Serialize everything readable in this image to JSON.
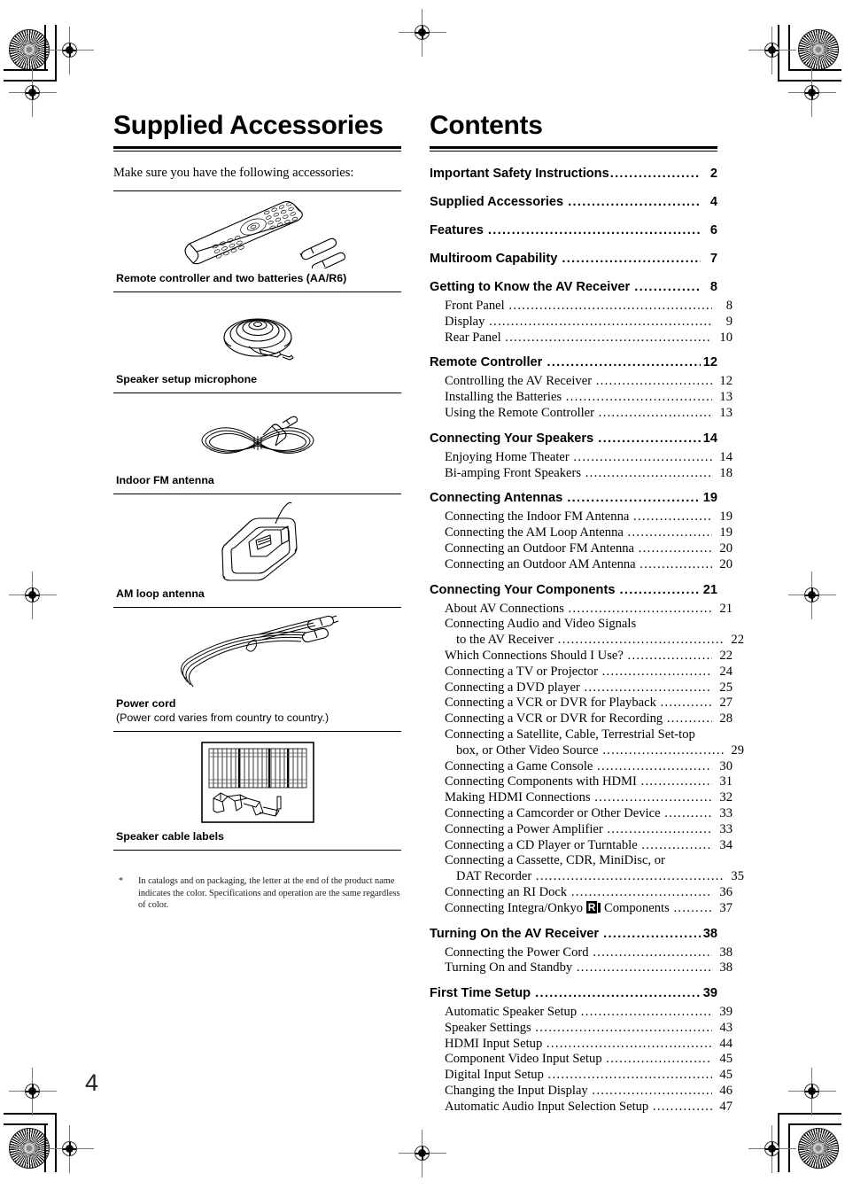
{
  "page": {
    "number": "4"
  },
  "left": {
    "title": "Supplied Accessories",
    "intro": "Make sure you have the following accessories:",
    "accessories": [
      {
        "caption": "Remote controller and two batteries (AA/R6)",
        "sub": "",
        "art": "remote-controller-illustration"
      },
      {
        "caption": "Speaker setup microphone",
        "sub": "",
        "art": "setup-microphone-illustration"
      },
      {
        "caption": "Indoor FM antenna",
        "sub": "",
        "art": "fm-antenna-illustration"
      },
      {
        "caption": "AM loop antenna",
        "sub": "",
        "art": "am-loop-antenna-illustration"
      },
      {
        "caption": "Power cord",
        "sub": "(Power cord varies from country to country.)",
        "art": "power-cord-illustration"
      },
      {
        "caption": "Speaker cable labels",
        "sub": "",
        "art": "speaker-cable-labels-illustration"
      }
    ],
    "footnote_marker": "*",
    "footnote": "In catalogs and on packaging, the letter at the end of the product name indicates the color. Specifications and operation are the same regardless of color."
  },
  "right": {
    "title": "Contents",
    "entries": [
      {
        "level": 1,
        "label": "Important Safety Instructions",
        "page": "2"
      },
      {
        "level": 1,
        "label": "Supplied Accessories ",
        "page": "4"
      },
      {
        "level": 1,
        "label": "Features ",
        "page": "6"
      },
      {
        "level": 1,
        "label": "Multiroom Capability ",
        "page": "7"
      },
      {
        "level": 1,
        "label": "Getting to Know the AV Receiver ",
        "page": "8"
      },
      {
        "level": 2,
        "label": "Front Panel ",
        "page": "8"
      },
      {
        "level": 2,
        "label": "Display ",
        "page": "9"
      },
      {
        "level": 2,
        "label": "Rear Panel ",
        "page": "10"
      },
      {
        "level": 1,
        "label": "Remote Controller ",
        "page": "12"
      },
      {
        "level": 2,
        "label": "Controlling the AV Receiver ",
        "page": "12"
      },
      {
        "level": 2,
        "label": "Installing the Batteries ",
        "page": "13"
      },
      {
        "level": 2,
        "label": "Using the Remote Controller ",
        "page": "13"
      },
      {
        "level": 1,
        "label": "Connecting Your Speakers ",
        "page": "14"
      },
      {
        "level": 2,
        "label": "Enjoying Home Theater ",
        "page": "14"
      },
      {
        "level": 2,
        "label": "Bi-amping Front Speakers ",
        "page": "18"
      },
      {
        "level": 1,
        "label": "Connecting Antennas ",
        "page": "19"
      },
      {
        "level": 2,
        "label": "Connecting the Indoor FM Antenna ",
        "page": "19"
      },
      {
        "level": 2,
        "label": "Connecting the AM Loop Antenna ",
        "page": "19"
      },
      {
        "level": 2,
        "label": "Connecting an Outdoor FM Antenna ",
        "page": "20"
      },
      {
        "level": 2,
        "label": "Connecting an Outdoor AM Antenna ",
        "page": "20"
      },
      {
        "level": 1,
        "label": "Connecting Your Components ",
        "page": "21"
      },
      {
        "level": 2,
        "label": "About AV Connections ",
        "page": "21"
      },
      {
        "level": 2,
        "label": "Connecting Audio and Video Signals",
        "page": "",
        "nodots": true
      },
      {
        "level": 2,
        "label": "to the AV Receiver ",
        "page": "22",
        "cont": true
      },
      {
        "level": 2,
        "label": "Which Connections Should I Use? ",
        "page": "22"
      },
      {
        "level": 2,
        "label": "Connecting a TV or Projector ",
        "page": "24"
      },
      {
        "level": 2,
        "label": "Connecting a DVD player ",
        "page": "25"
      },
      {
        "level": 2,
        "label": "Connecting a VCR or DVR for Playback ",
        "page": "27"
      },
      {
        "level": 2,
        "label": "Connecting a VCR or DVR for Recording ",
        "page": "28"
      },
      {
        "level": 2,
        "label": "Connecting a Satellite, Cable, Terrestrial Set-top",
        "page": "",
        "nodots": true
      },
      {
        "level": 2,
        "label": "box, or Other Video Source ",
        "page": "29",
        "cont": true
      },
      {
        "level": 2,
        "label": "Connecting a Game Console ",
        "page": "30"
      },
      {
        "level": 2,
        "label": "Connecting Components with HDMI ",
        "page": "31"
      },
      {
        "level": 2,
        "label": "Making HDMI Connections ",
        "page": "32"
      },
      {
        "level": 2,
        "label": "Connecting a Camcorder or Other Device ",
        "page": "33"
      },
      {
        "level": 2,
        "label": "Connecting a Power Amplifier ",
        "page": "33"
      },
      {
        "level": 2,
        "label": "Connecting a CD Player or Turntable ",
        "page": "34"
      },
      {
        "level": 2,
        "label": "Connecting a Cassette, CDR, MiniDisc, or",
        "page": "",
        "nodots": true
      },
      {
        "level": 2,
        "label": "DAT Recorder ",
        "page": "35",
        "cont": true
      },
      {
        "level": 2,
        "label": "Connecting an RI Dock ",
        "page": "36"
      },
      {
        "level": 2,
        "label": "Connecting Integra/Onkyo ",
        "label_after": " Components ",
        "page": "37",
        "ri_logo": true
      },
      {
        "level": 1,
        "label": "Turning On the AV Receiver ",
        "page": "38"
      },
      {
        "level": 2,
        "label": "Connecting the Power Cord ",
        "page": "38"
      },
      {
        "level": 2,
        "label": "Turning On and Standby ",
        "page": "38"
      },
      {
        "level": 1,
        "label": "First Time Setup ",
        "page": "39"
      },
      {
        "level": 2,
        "label": "Automatic Speaker Setup ",
        "page": "39"
      },
      {
        "level": 2,
        "label": "Speaker Settings ",
        "page": "43"
      },
      {
        "level": 2,
        "label": "HDMI Input Setup ",
        "page": "44"
      },
      {
        "level": 2,
        "label": "Component Video Input Setup ",
        "page": "45"
      },
      {
        "level": 2,
        "label": "Digital Input Setup ",
        "page": "45"
      },
      {
        "level": 2,
        "label": "Changing the Input Display ",
        "page": "46"
      },
      {
        "level": 2,
        "label": "Automatic Audio Input Selection Setup ",
        "page": "47"
      }
    ]
  }
}
